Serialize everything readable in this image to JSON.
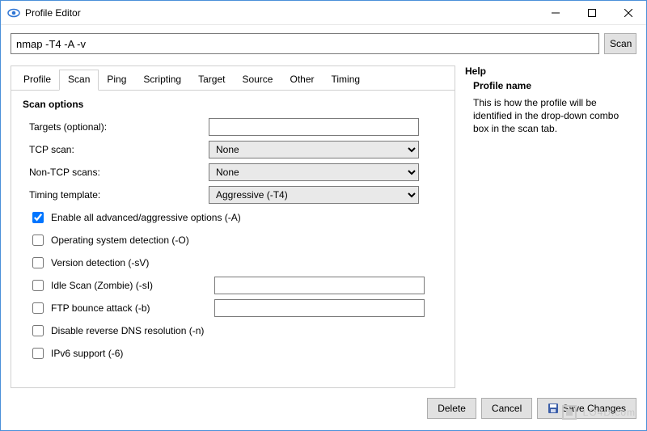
{
  "window": {
    "title": "Profile Editor",
    "minimize": "–",
    "maximize": "☐",
    "close": "✕"
  },
  "command": {
    "value": "nmap -T4 -A -v",
    "scan_label": "Scan"
  },
  "tabs": [
    "Profile",
    "Scan",
    "Ping",
    "Scripting",
    "Target",
    "Source",
    "Other",
    "Timing"
  ],
  "active_tab_index": 1,
  "section_title": "Scan options",
  "fields": {
    "targets_label": "Targets (optional):",
    "targets_value": "",
    "tcp_label": "TCP scan:",
    "tcp_value": "None",
    "nontcp_label": "Non-TCP scans:",
    "nontcp_value": "None",
    "timing_label": "Timing template:",
    "timing_value": "Aggressive (-T4)"
  },
  "checks": {
    "aggressive": {
      "label": "Enable all advanced/aggressive options (-A)",
      "checked": true
    },
    "os": {
      "label": "Operating system detection (-O)",
      "checked": false
    },
    "version": {
      "label": "Version detection (-sV)",
      "checked": false
    },
    "idle": {
      "label": "Idle Scan (Zombie) (-sI)",
      "checked": false,
      "input": ""
    },
    "ftp": {
      "label": "FTP bounce attack (-b)",
      "checked": false,
      "input": ""
    },
    "nodns": {
      "label": "Disable reverse DNS resolution (-n)",
      "checked": false
    },
    "ipv6": {
      "label": "IPv6 support (-6)",
      "checked": false
    }
  },
  "help": {
    "title": "Help",
    "subtitle": "Profile name",
    "body": "This is how the profile will be identified in the drop-down combo box in the scan tab."
  },
  "footer": {
    "delete": "Delete",
    "cancel": "Cancel",
    "save": "Save Changes"
  },
  "watermark": "LO4D.com"
}
